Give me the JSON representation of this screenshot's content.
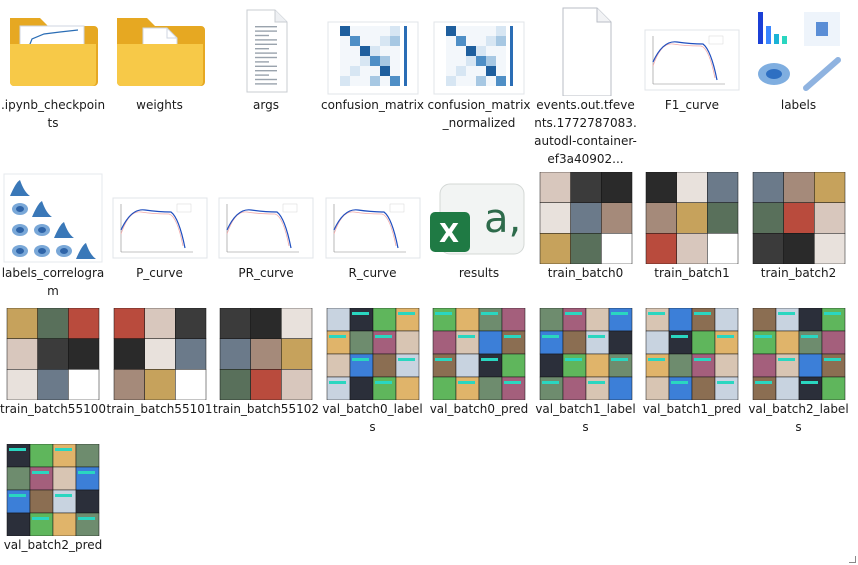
{
  "files": [
    {
      "name": ".ipynb_checkpoints",
      "kind": "folder-data"
    },
    {
      "name": "weights",
      "kind": "folder-doc"
    },
    {
      "name": "args",
      "kind": "textfile"
    },
    {
      "name": "confusion_matrix",
      "kind": "confusion"
    },
    {
      "name": "confusion_matrix_normalized",
      "kind": "confusion"
    },
    {
      "name": "events.out.tfevents.1772787083.autodl-container-ef3a40902...",
      "kind": "blank"
    },
    {
      "name": "F1_curve",
      "kind": "curve"
    },
    {
      "name": "labels",
      "kind": "labels"
    },
    {
      "name": "labels_correlogram",
      "kind": "correlogram"
    },
    {
      "name": "P_curve",
      "kind": "curve"
    },
    {
      "name": "PR_curve",
      "kind": "curve"
    },
    {
      "name": "R_curve",
      "kind": "curve"
    },
    {
      "name": "results",
      "kind": "excel"
    },
    {
      "name": "train_batch0",
      "kind": "mosaic"
    },
    {
      "name": "train_batch1",
      "kind": "mosaic"
    },
    {
      "name": "train_batch2",
      "kind": "mosaic"
    },
    {
      "name": "train_batch55100",
      "kind": "mosaic"
    },
    {
      "name": "train_batch55101",
      "kind": "mosaic"
    },
    {
      "name": "train_batch55102",
      "kind": "mosaic"
    },
    {
      "name": "val_batch0_labels",
      "kind": "val"
    },
    {
      "name": "val_batch0_pred",
      "kind": "val"
    },
    {
      "name": "val_batch1_labels",
      "kind": "val"
    },
    {
      "name": "val_batch1_pred",
      "kind": "val"
    },
    {
      "name": "val_batch2_labels",
      "kind": "val"
    },
    {
      "name": "val_batch2_pred",
      "kind": "val"
    }
  ],
  "colors": {
    "folder": "#f7c948",
    "folder_dark": "#e6a822",
    "accent_blue": "#2a6db5",
    "excel_green": "#1f7a44"
  }
}
